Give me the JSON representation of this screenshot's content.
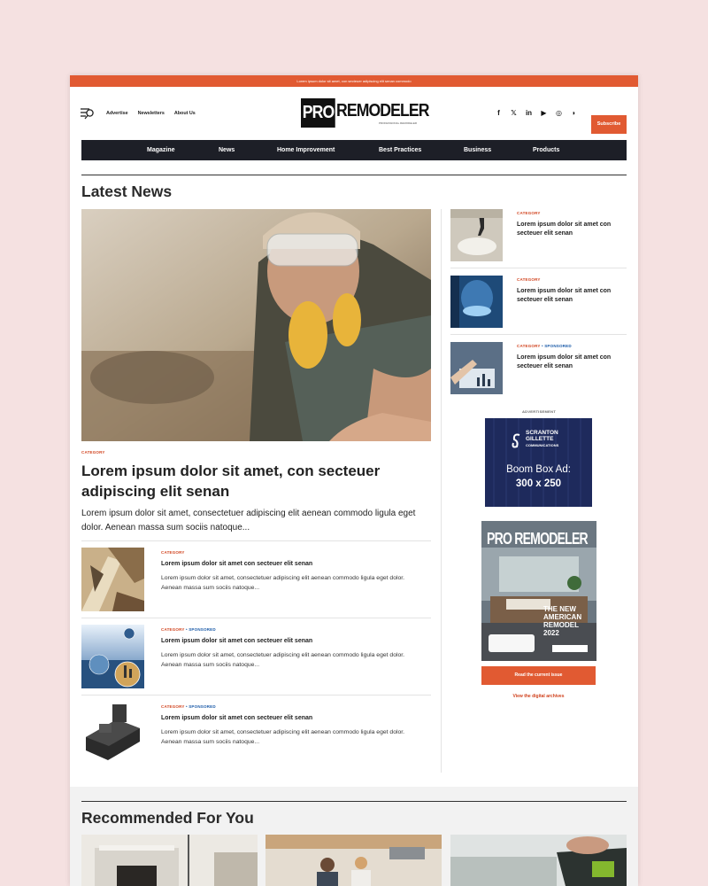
{
  "topbar": {
    "text": "Lorem ipsum dolor sit amet, con secteuer adipiscing elit senan commodo"
  },
  "header": {
    "util_links": [
      "Advertise",
      "Newsletters",
      "About Us"
    ],
    "logo_pro": "PRO",
    "logo_remodeler": "REMODELER",
    "logo_tagline": "PROFESSIONAL REMODELER",
    "social": [
      "f",
      "𝕏",
      "in",
      "▶",
      "◎",
      "◗"
    ],
    "subscribe": "Subscribe"
  },
  "nav": [
    "Magazine",
    "News",
    "Home Improvement",
    "Best Practices",
    "Business",
    "Products"
  ],
  "latest": {
    "title": "Latest News",
    "hero": {
      "category": "CATEGORY",
      "title": "Lorem ipsum dolor sit amet, con secteuer adipiscing elit senan",
      "excerpt": "Lorem ipsum dolor sit amet, consectetuer adipiscing elit aenean commodo ligula eget dolor. Aenean massa sum sociis natoque..."
    },
    "list": [
      {
        "category": "CATEGORY",
        "sponsored": "",
        "title": "Lorem ipsum dolor sit amet con secteuer elit senan",
        "excerpt": "Lorem ipsum dolor sit amet, consectetuer adipiscing elit aenean commodo ligula eget dolor. Aenean massa sum sociis natoque..."
      },
      {
        "category": "CATEGORY",
        "sponsored": "• SPONSORED",
        "title": "Lorem ipsum dolor sit amet con secteuer elit senan",
        "excerpt": "Lorem ipsum dolor sit amet, consectetuer adipiscing elit aenean commodo ligula eget dolor. Aenean massa sum sociis natoque..."
      },
      {
        "category": "CATEGORY",
        "sponsored": "• SPONSORED",
        "title": "Lorem ipsum dolor sit amet con secteuer elit senan",
        "excerpt": "Lorem ipsum dolor sit amet, consectetuer adipiscing elit aenean commodo ligula eget dolor. Aenean massa sum sociis natoque..."
      }
    ]
  },
  "sidebar": {
    "items": [
      {
        "category": "CATEGORY",
        "sponsored": "",
        "title": "Lorem ipsum dolor sit amet con secteuer elit senan"
      },
      {
        "category": "CATEGORY",
        "sponsored": "",
        "title": "Lorem ipsum dolor sit amet con secteuer elit senan"
      },
      {
        "category": "CATEGORY",
        "sponsored": "• SPONSORED",
        "title": "Lorem ipsum dolor sit amet con secteuer elit senan"
      }
    ],
    "ad_label": "ADVERTISEMENT",
    "ad": {
      "brand_line1": "SCRANTON",
      "brand_line2": "GILLETTE",
      "brand_line3": "COMMUNICATIONS",
      "text1": "Boom Box Ad:",
      "text2": "300 x 250"
    },
    "magazine": {
      "title_pro": "PRO",
      "title_rem": "REMODELER",
      "headline": "THE NEW AMERICAN REMODEL 2022"
    },
    "read_button": "Read the current issue",
    "archive_link": "View the digital archives"
  },
  "recommended": {
    "title": "Recommended For You"
  },
  "colors": {
    "accent": "#e15a32",
    "nav_bg": "#1d1f27",
    "sponsored": "#1a5aa8",
    "page_bg": "#f5e1e1"
  }
}
